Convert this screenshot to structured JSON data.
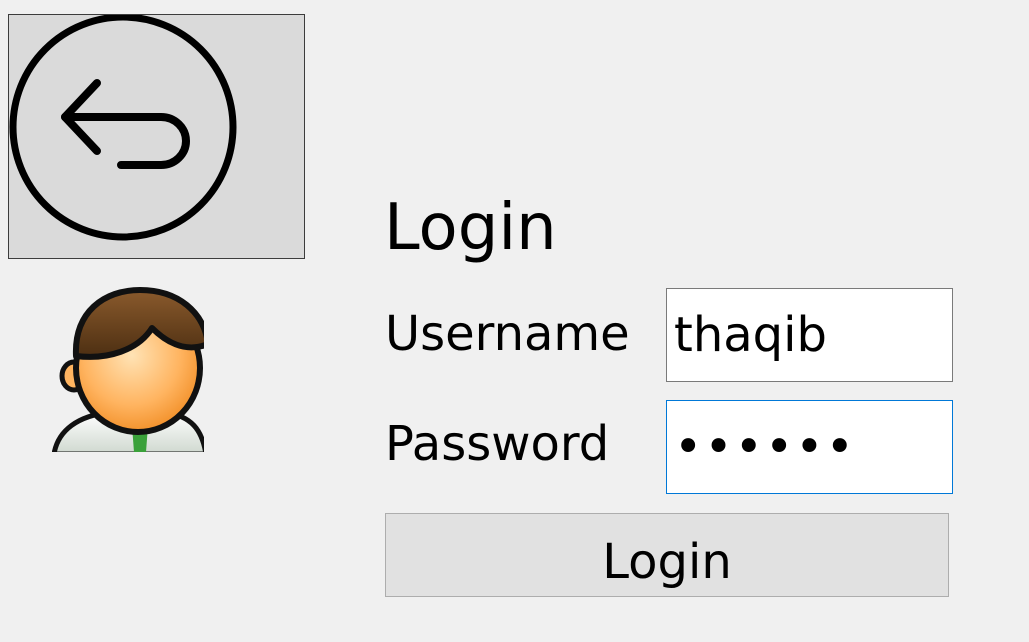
{
  "back_button": {
    "icon": "back-arrow-icon"
  },
  "avatar": {
    "icon": "user-avatar-icon"
  },
  "form": {
    "title": "Login",
    "username_label": "Username",
    "username_value": "thaqib",
    "password_label": "Password",
    "password_value": "••••••",
    "login_button_label": "Login"
  },
  "colors": {
    "background": "#f0f0f0",
    "focus_border": "#0078d7",
    "button_face": "#e1e1e1"
  }
}
